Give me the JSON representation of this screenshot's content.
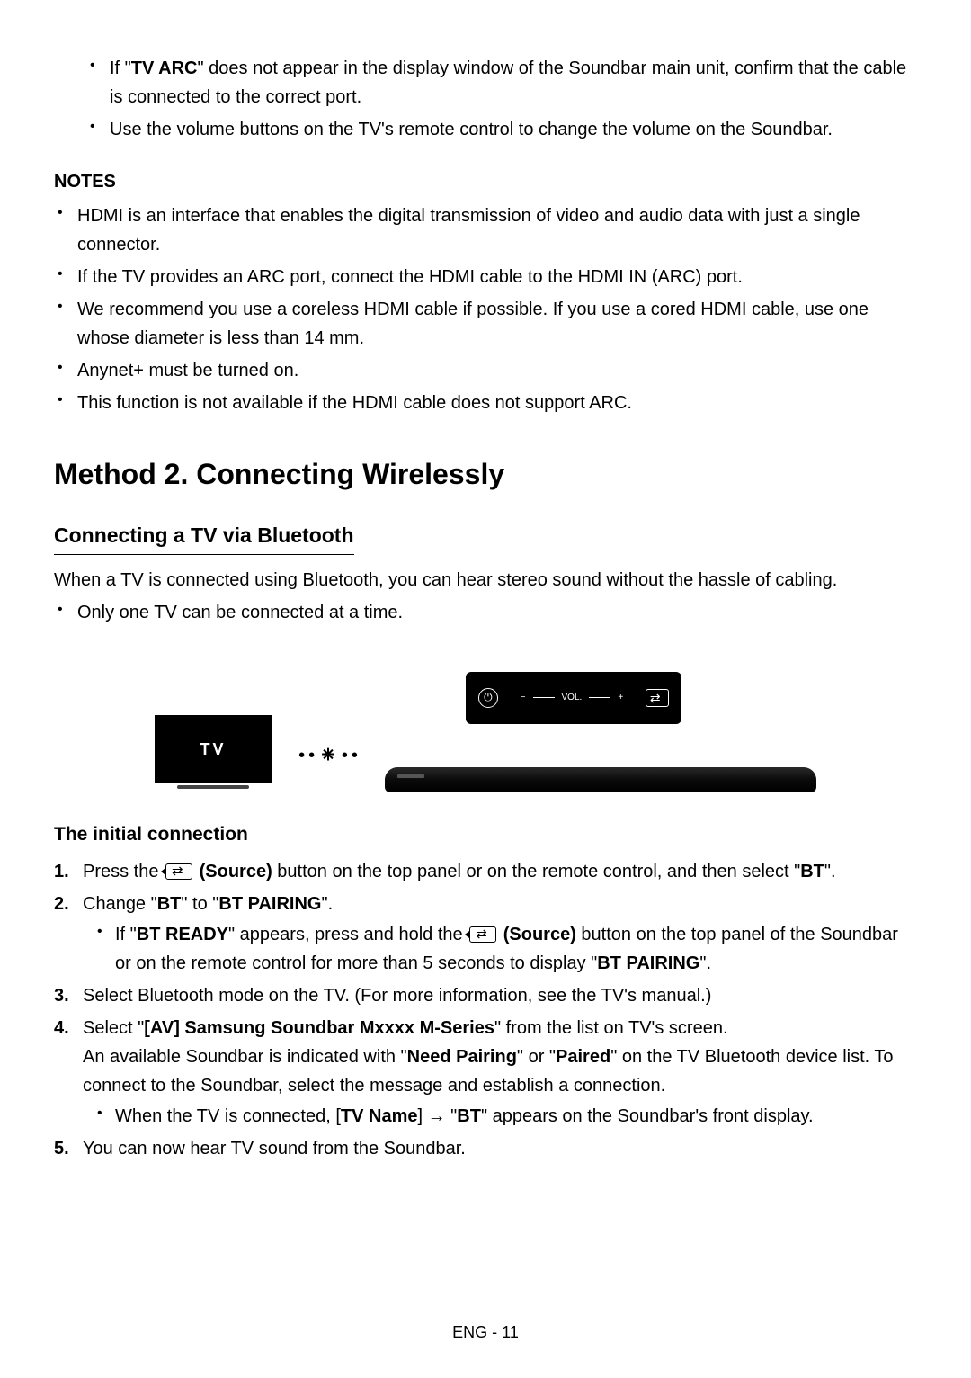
{
  "top_bullets": {
    "item1_pre": "If \"",
    "item1_bold": "TV ARC",
    "item1_post": "\" does not appear in the display window of the Soundbar main unit, confirm that the cable is connected to the correct port.",
    "item2": "Use the volume buttons on the TV's remote control to change the volume on the Soundbar."
  },
  "notes": {
    "heading": "NOTES",
    "items": [
      "HDMI is an interface that enables the digital transmission of video and audio data with just a single connector.",
      "If the TV provides an ARC port, connect the HDMI cable to the HDMI IN (ARC) port.",
      "We recommend you use a coreless HDMI cable if possible. If you use a cored HDMI cable, use one whose diameter is less than 14 mm.",
      "Anynet+ must be turned on.",
      "This function is not available if the HDMI cable does not support ARC."
    ]
  },
  "method": {
    "title": "Method 2. Connecting Wirelessly",
    "subheading": "Connecting a TV via Bluetooth",
    "intro": "When a TV is connected using Bluetooth, you can hear stereo sound without the hassle of cabling.",
    "bullet": "Only one TV can be connected at a time."
  },
  "diagram": {
    "tv_label": "TV",
    "vol_label": "VOL.",
    "minus": "−",
    "plus": "+"
  },
  "initial": {
    "heading": "The initial connection",
    "step1_a": "Press the ",
    "step1_b": " (Source)",
    "step1_c": " button on the top panel or on the remote control, and then select \"",
    "step1_d": "BT",
    "step1_e": "\".",
    "step2_a": "Change \"",
    "step2_b": "BT",
    "step2_c": "\" to \"",
    "step2_d": "BT PAIRING",
    "step2_e": "\".",
    "step2_sub_a": "If \"",
    "step2_sub_b": "BT READY",
    "step2_sub_c": "\" appears, press and hold the ",
    "step2_sub_d": " (Source)",
    "step2_sub_e": " button on the top panel of the Soundbar or on the remote control for more than 5 seconds to display \"",
    "step2_sub_f": "BT PAIRING",
    "step2_sub_g": "\".",
    "step3": "Select Bluetooth mode on the TV. (For more information, see the TV's manual.)",
    "step4_a": "Select \"",
    "step4_b": "[AV] Samsung Soundbar Mxxxx M-Series",
    "step4_c": "\" from the list on TV's screen.",
    "step4_line2_a": "An available Soundbar is indicated with \"",
    "step4_line2_b": "Need Pairing",
    "step4_line2_c": "\" or \"",
    "step4_line2_d": "Paired",
    "step4_line2_e": "\" on the TV Bluetooth device list. To connect to the Soundbar, select the message and establish a connection.",
    "step4_sub_a": "When the TV is connected, [",
    "step4_sub_b": "TV Name",
    "step4_sub_c": "] → \"",
    "step4_sub_d": "BT",
    "step4_sub_e": "\" appears on the Soundbar's front display.",
    "step5": "You can now hear TV sound from the Soundbar."
  },
  "footer": "ENG - 11"
}
